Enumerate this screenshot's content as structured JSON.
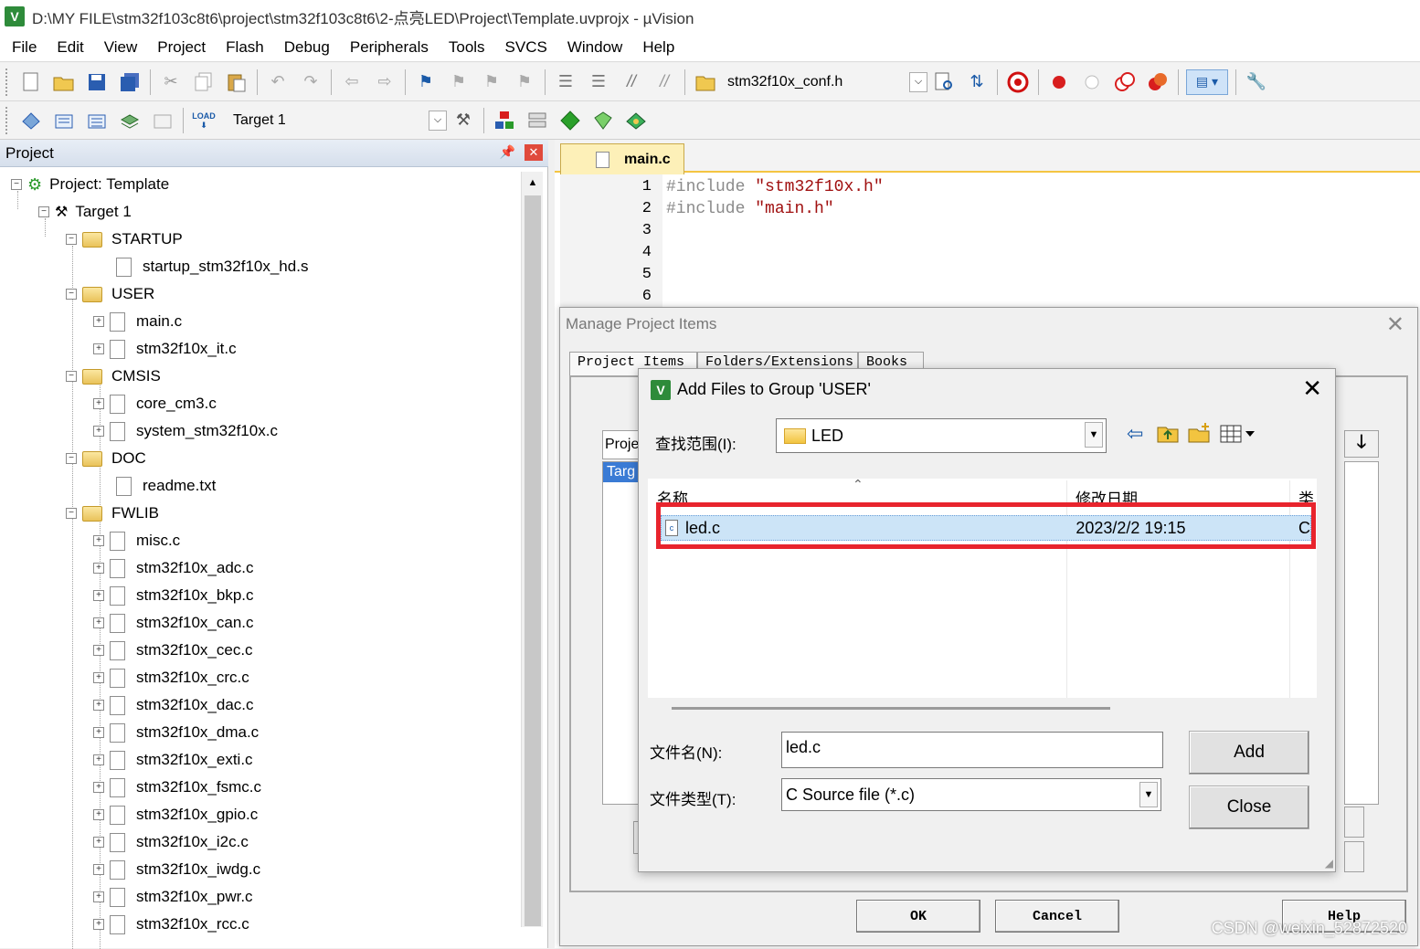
{
  "window": {
    "title": "D:\\MY FILE\\stm32f103c8t6\\project\\stm32f103c8t6\\2-点亮LED\\Project\\Template.uvprojx - µVision",
    "app_icon": "V"
  },
  "menu": [
    "File",
    "Edit",
    "View",
    "Project",
    "Flash",
    "Debug",
    "Peripherals",
    "Tools",
    "SVCS",
    "Window",
    "Help"
  ],
  "toolbar1": {
    "find_combo_value": "stm32f10x_conf.h"
  },
  "toolbar2": {
    "load_label": "LOAD",
    "target_combo_value": "Target 1"
  },
  "project_panel": {
    "title": "Project",
    "pin_glyph": "📌",
    "close_glyph": "✕",
    "tree": [
      {
        "label": "Project: Template"
      },
      {
        "label": "Target 1"
      },
      {
        "label": "STARTUP"
      },
      {
        "label": "startup_stm32f10x_hd.s"
      },
      {
        "label": "USER"
      },
      {
        "label": "main.c"
      },
      {
        "label": "stm32f10x_it.c"
      },
      {
        "label": "CMSIS"
      },
      {
        "label": "core_cm3.c"
      },
      {
        "label": "system_stm32f10x.c"
      },
      {
        "label": "DOC"
      },
      {
        "label": "readme.txt"
      },
      {
        "label": "FWLIB"
      },
      {
        "label": "misc.c"
      },
      {
        "label": "stm32f10x_adc.c"
      },
      {
        "label": "stm32f10x_bkp.c"
      },
      {
        "label": "stm32f10x_can.c"
      },
      {
        "label": "stm32f10x_cec.c"
      },
      {
        "label": "stm32f10x_crc.c"
      },
      {
        "label": "stm32f10x_dac.c"
      },
      {
        "label": "stm32f10x_dma.c"
      },
      {
        "label": "stm32f10x_exti.c"
      },
      {
        "label": "stm32f10x_fsmc.c"
      },
      {
        "label": "stm32f10x_gpio.c"
      },
      {
        "label": "stm32f10x_i2c.c"
      },
      {
        "label": "stm32f10x_iwdg.c"
      },
      {
        "label": "stm32f10x_pwr.c"
      },
      {
        "label": "stm32f10x_rcc.c"
      }
    ]
  },
  "editor": {
    "tab_label": "main.c",
    "line_numbers": [
      "1",
      "2",
      "3",
      "4",
      "5",
      "6"
    ],
    "lines": [
      {
        "kw": "#include",
        "str": "\"stm32f10x.h\""
      },
      {
        "kw": "#include",
        "str": "\"main.h\""
      }
    ]
  },
  "manage_dialog": {
    "title": "Manage Project Items",
    "close_glyph": "✕",
    "tabs": [
      "Project Items",
      "Folders/Extensions",
      "Books"
    ],
    "groups_label": "Proje",
    "targets_item": "Targ",
    "buttons": {
      "ok": "OK",
      "cancel": "Cancel",
      "help": "Help"
    }
  },
  "add_files_dialog": {
    "title": "Add Files to Group 'USER'",
    "close_glyph": "✕",
    "look_in_label": "查找范围(I):",
    "look_in_value": "LED",
    "columns": {
      "name": "名称",
      "modified": "修改日期",
      "type": "类"
    },
    "files": [
      {
        "name": "led.c",
        "modified": "2023/2/2 19:15",
        "type": "C"
      }
    ],
    "filename_label": "文件名(N):",
    "filename_value": "led.c",
    "filetype_label": "文件类型(T):",
    "filetype_value": "C Source file (*.c)",
    "add_button": "Add",
    "close_button": "Close"
  },
  "watermark": "CSDN @weixin_52872520",
  "colors": {
    "highlight_border": "#e8242d",
    "selection_bg": "#cce4f7",
    "tab_active": "#fdf0b8",
    "keyword": "#8b8b8b",
    "string": "#a01010"
  }
}
